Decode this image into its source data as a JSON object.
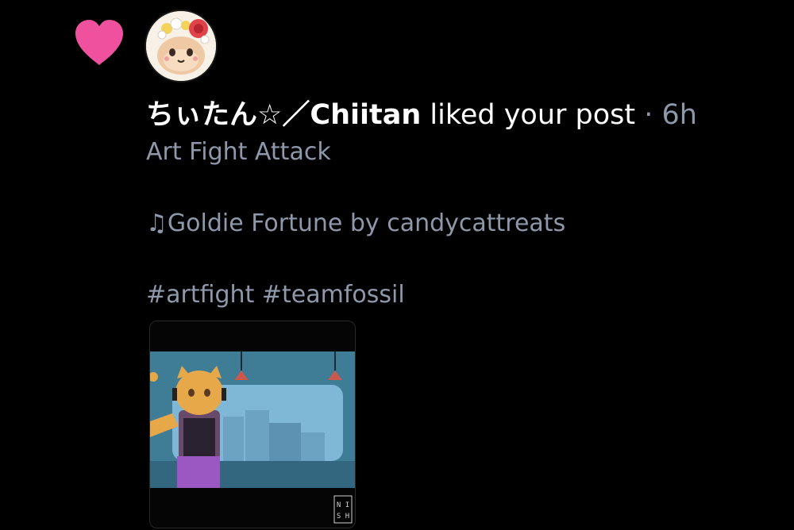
{
  "notification": {
    "type": "like",
    "user_name": "ちぃたん☆／Chiitan",
    "action": " liked your post",
    "separator": " · ",
    "time_ago": "6h",
    "heart_color": "#f0519f"
  },
  "post": {
    "title": "Art Fight Attack",
    "song": "♫Goldie Fortune by candycattreats",
    "tags": "#artfight #teamfossil",
    "image_watermark_line1": "N I",
    "image_watermark_line2": "S H"
  },
  "colors": {
    "background": "#000000",
    "primary_text": "#ffffff",
    "secondary_text": "#8d98ab"
  }
}
